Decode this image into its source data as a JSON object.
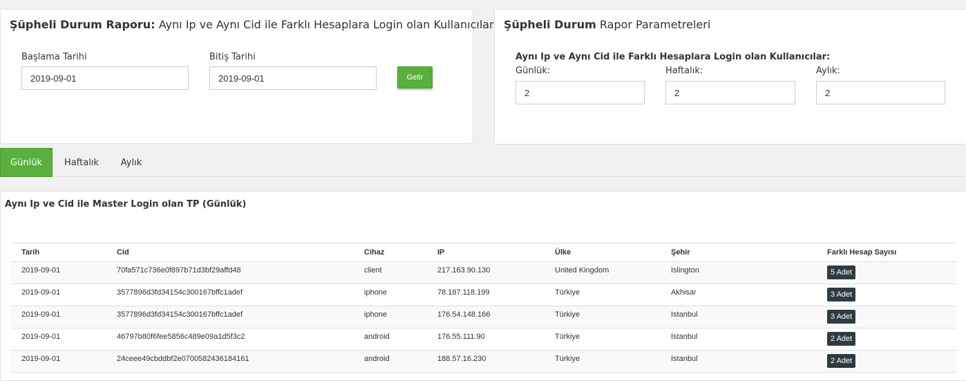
{
  "filter_panel": {
    "title_bold": "Şüpheli Durum Raporu:",
    "title_rest": "Aynı Ip ve Aynı Cid ile Farklı Hesaplara Login olan Kullanıcılar",
    "start_label": "Başlama Tarihi",
    "start_value": "2019-09-01",
    "end_label": "Bitiş Tarihi",
    "end_value": "2019-09-01",
    "submit_label": "Getir"
  },
  "params_panel": {
    "title_bold": "Şüpheli Durum",
    "title_rest": "Rapor Parametreleri",
    "subheading": "Aynı Ip ve Aynı Cid ile Farklı Hesaplara Login olan Kullanıcılar:",
    "daily_label": "Günlük:",
    "daily_value": "2",
    "weekly_label": "Haftalık:",
    "weekly_value": "2",
    "monthly_label": "Aylık:",
    "monthly_value": "2"
  },
  "tabs": [
    {
      "label": "Günlük",
      "active": true
    },
    {
      "label": "Haftalık",
      "active": false
    },
    {
      "label": "Aylık",
      "active": false
    }
  ],
  "table_panel": {
    "title": "Aynı Ip ve Cid ile Master Login olan TP (Günlük)",
    "columns": [
      "Tarih",
      "Cid",
      "Cihaz",
      "IP",
      "Ülke",
      "Şehir",
      "Farklı Hesap Sayısı"
    ],
    "rows": [
      {
        "tarih": "2019-09-01",
        "cid": "70fa571c736e0f897b71d3bf29affd48",
        "cihaz": "client",
        "ip": "217.163.90.130",
        "ulke": "United Kingdom",
        "sehir": "Islington",
        "sayi": "5 Adet"
      },
      {
        "tarih": "2019-09-01",
        "cid": "3577896d3fd34154c300167bffc1adef",
        "cihaz": "iphone",
        "ip": "78.187.118.199",
        "ulke": "Türkiye",
        "sehir": "Akhisar",
        "sayi": "3 Adet"
      },
      {
        "tarih": "2019-09-01",
        "cid": "3577896d3fd34154c300167bffc1adef",
        "cihaz": "iphone",
        "ip": "176.54.148.166",
        "ulke": "Türkiye",
        "sehir": "Istanbul",
        "sayi": "3 Adet"
      },
      {
        "tarih": "2019-09-01",
        "cid": "46797b80f6fee5856c489e09a1d5f3c2",
        "cihaz": "android",
        "ip": "176.55.111.90",
        "ulke": "Türkiye",
        "sehir": "Istanbul",
        "sayi": "2 Adet"
      },
      {
        "tarih": "2019-09-01",
        "cid": "24ceee49cbddbf2e0700582436184161",
        "cihaz": "android",
        "ip": "188.57.16.230",
        "ulke": "Türkiye",
        "sehir": "Istanbul",
        "sayi": "2 Adet"
      }
    ]
  },
  "colors": {
    "accent": "#5ab03d",
    "badge": "#2f3b40"
  }
}
